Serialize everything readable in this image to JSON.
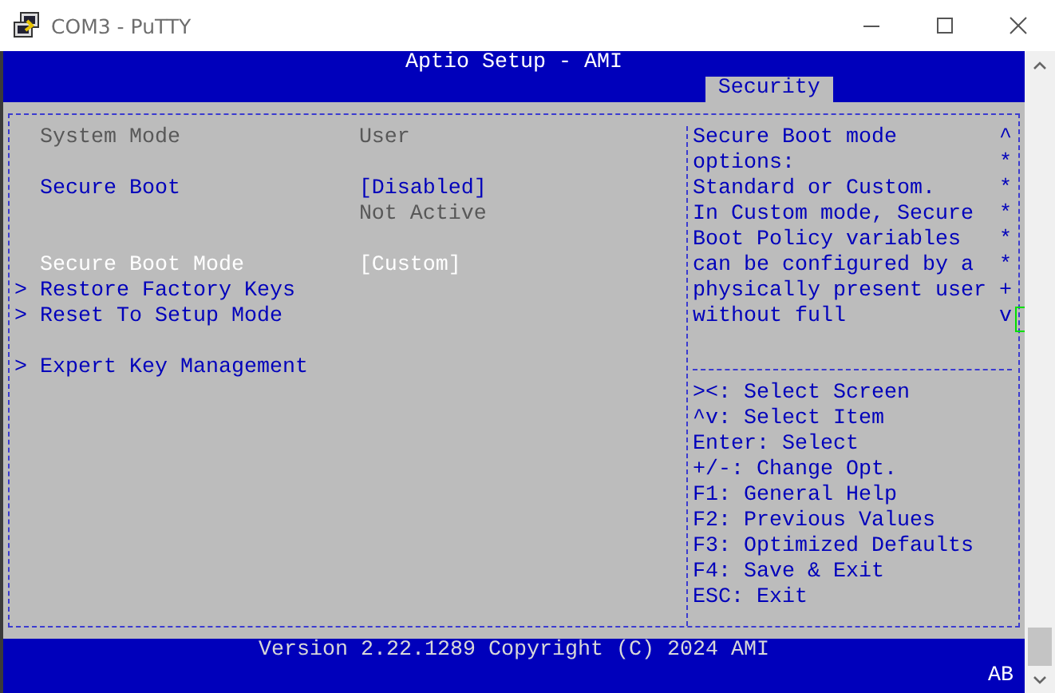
{
  "window": {
    "title": "COM3 - PuTTY"
  },
  "bios": {
    "title": "Aptio Setup - AMI",
    "tabs": [
      {
        "label": "Security",
        "selected": true
      }
    ],
    "settings": [
      {
        "kind": "info",
        "label": "System Mode",
        "value": "User",
        "selected": false
      },
      {
        "kind": "blank"
      },
      {
        "kind": "setting",
        "label": "Secure Boot",
        "value": "[Disabled]",
        "selected": false
      },
      {
        "kind": "status",
        "value": "Not Active"
      },
      {
        "kind": "blank"
      },
      {
        "kind": "setting",
        "label": "Secure Boot Mode",
        "value": "[Custom]",
        "selected": true
      },
      {
        "kind": "submenu",
        "marker": ">",
        "label": "Restore Factory Keys",
        "selected": false
      },
      {
        "kind": "submenu",
        "marker": ">",
        "label": "Reset To Setup Mode",
        "selected": false
      },
      {
        "kind": "blank"
      },
      {
        "kind": "submenu",
        "marker": ">",
        "label": "Expert Key Management",
        "selected": false
      }
    ],
    "help": [
      {
        "text": "Secure Boot mode",
        "mark": "^"
      },
      {
        "text": "options:",
        "mark": "*"
      },
      {
        "text": "Standard or Custom.",
        "mark": "*"
      },
      {
        "text": "In Custom mode, Secure",
        "mark": "*"
      },
      {
        "text": "Boot Policy variables",
        "mark": "*"
      },
      {
        "text": "can be configured by a",
        "mark": "*"
      },
      {
        "text": "physically present user",
        "mark": "+"
      },
      {
        "text": "without full",
        "mark": "v"
      }
    ],
    "keys": [
      "><: Select Screen",
      "^v: Select Item",
      "Enter: Select",
      "+/-: Change Opt.",
      "F1: General Help",
      "F2: Previous Values",
      "F3: Optimized Defaults",
      "F4: Save & Exit",
      "ESC: Exit"
    ],
    "footer": "Version 2.22.1289 Copyright (C) 2024 AMI",
    "status": "AB"
  }
}
